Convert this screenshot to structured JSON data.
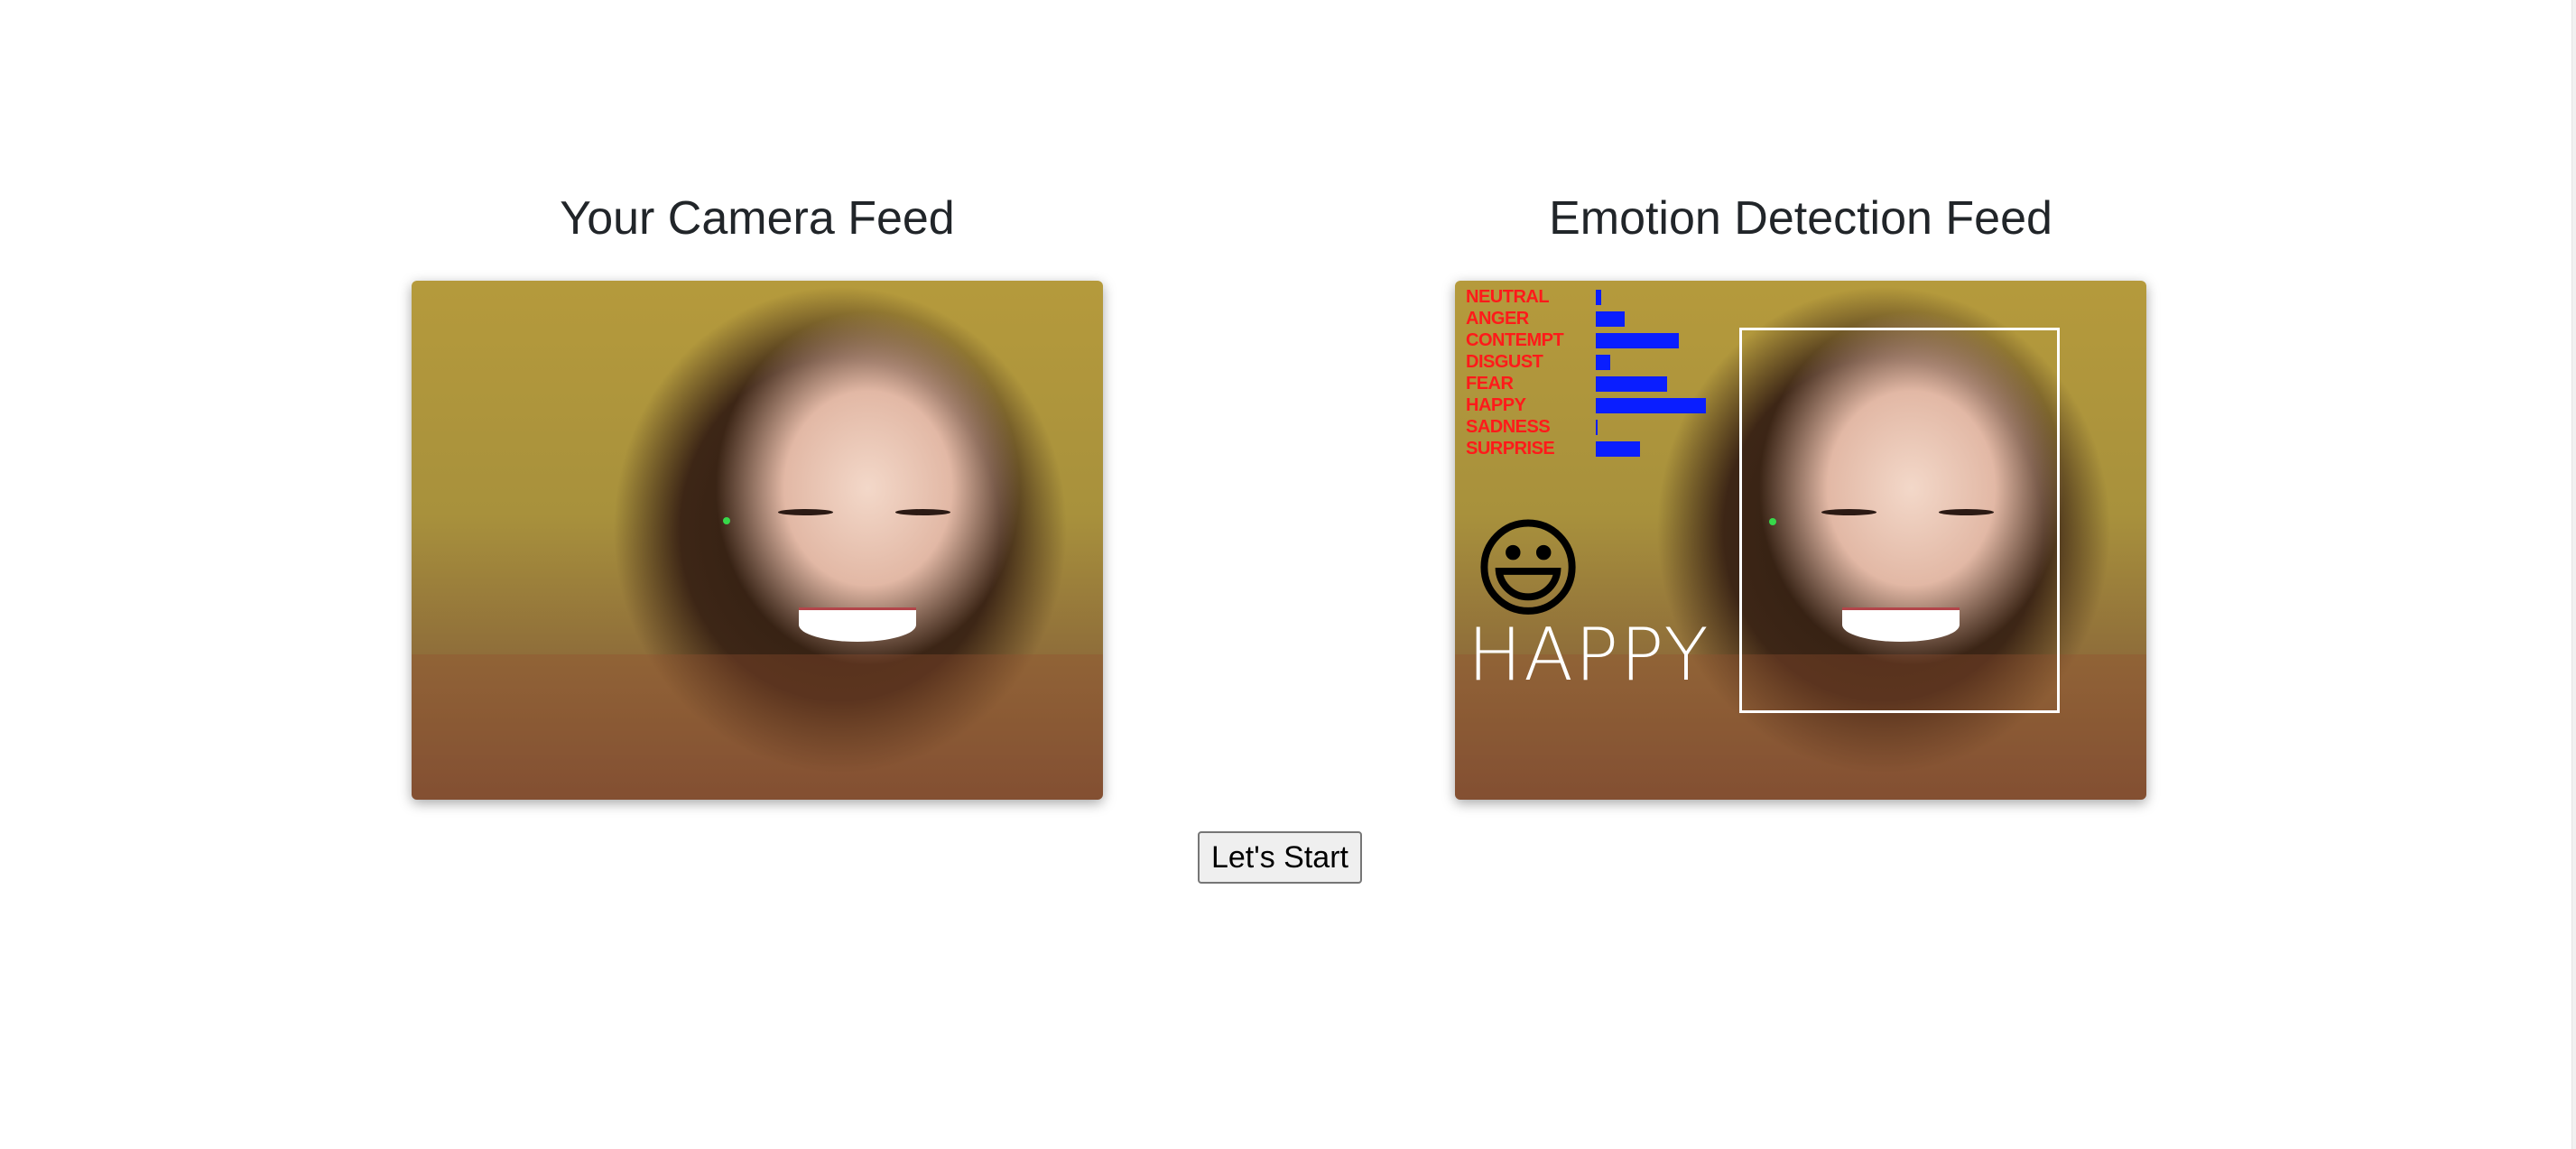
{
  "camera_feed": {
    "title": "Your Camera Feed"
  },
  "emotion_feed": {
    "title": "Emotion Detection Feed",
    "emotions": [
      {
        "label": "NEUTRAL",
        "level": 0.05
      },
      {
        "label": "ANGER",
        "level": 0.26
      },
      {
        "label": "CONTEMPT",
        "level": 0.75
      },
      {
        "label": "DISGUST",
        "level": 0.13
      },
      {
        "label": "FEAR",
        "level": 0.65
      },
      {
        "label": "HAPPY",
        "level": 1.0
      },
      {
        "label": "SADNESS",
        "level": 0.02
      },
      {
        "label": "SURPRISE",
        "level": 0.4
      }
    ],
    "detected_emotion": "HAPPY",
    "detected_emoji": "😃",
    "label_color": "#ff1a1a",
    "bar_color": "#0a1eff"
  },
  "start_button": {
    "label": "Let's Start"
  }
}
